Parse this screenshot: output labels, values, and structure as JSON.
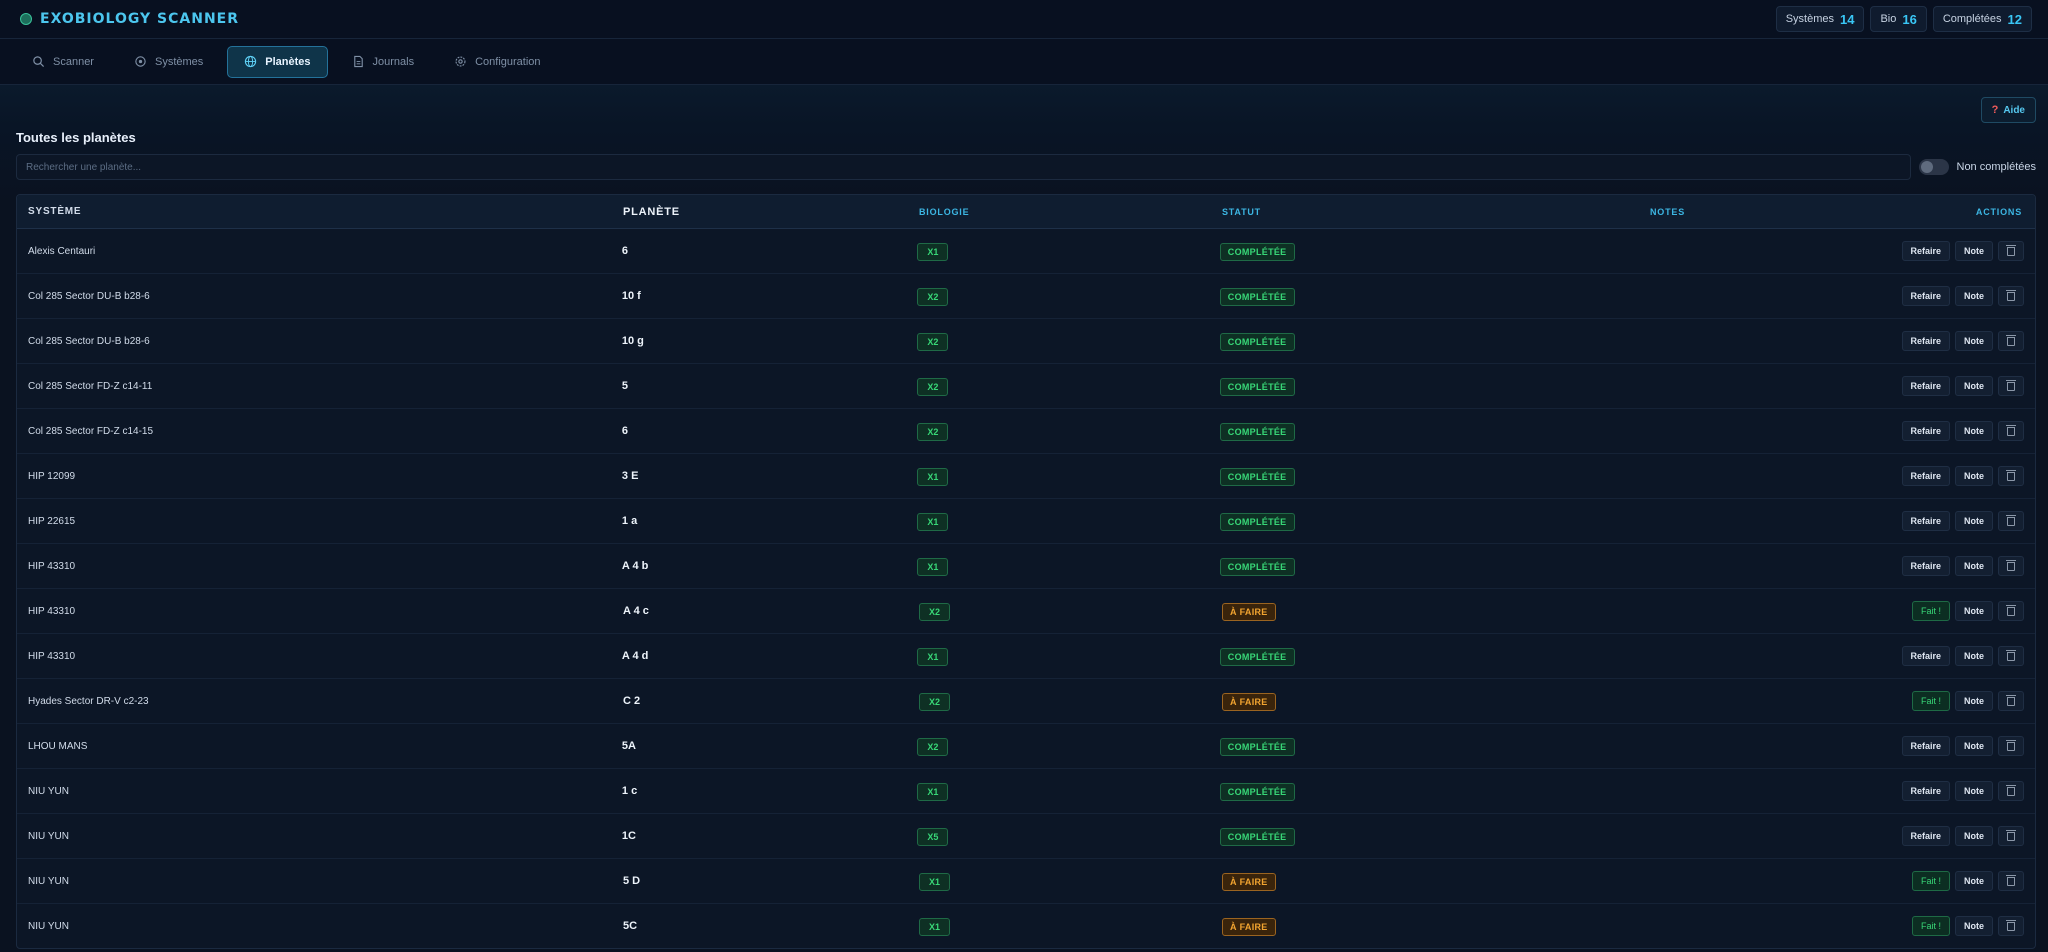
{
  "app": {
    "title": "EXOBIOLOGY SCANNER"
  },
  "stats": [
    {
      "label": "Systèmes",
      "value": "14"
    },
    {
      "label": "Bio",
      "value": "16"
    },
    {
      "label": "Complétées",
      "value": "12"
    }
  ],
  "tabs": [
    {
      "label": "Scanner",
      "icon": "search-icon"
    },
    {
      "label": "Systèmes",
      "icon": "target-icon"
    },
    {
      "label": "Planètes",
      "icon": "globe-icon",
      "active": true
    },
    {
      "label": "Journals",
      "icon": "document-icon"
    },
    {
      "label": "Configuration",
      "icon": "gear-icon"
    }
  ],
  "help": {
    "label": "Aide"
  },
  "page": {
    "title": "Toutes les planètes"
  },
  "search": {
    "placeholder": "Rechercher une planète..."
  },
  "filter": {
    "label": "Non complétées"
  },
  "table": {
    "headers": {
      "system": "SYSTÈME",
      "planet": "PLANÈTE",
      "bio": "BIOLOGIE",
      "status": "STATUT",
      "notes": "NOTES",
      "actions": "ACTIONS"
    },
    "rows": [
      {
        "system": "Alexis Centauri",
        "planet": "6",
        "bio": "X1",
        "status": "COMPLÉTÉE",
        "state": "done",
        "action": "Refaire"
      },
      {
        "system": "Col 285 Sector DU-B b28-6",
        "planet": "10 f",
        "bio": "X2",
        "status": "COMPLÉTÉE",
        "state": "done",
        "action": "Refaire"
      },
      {
        "system": "Col 285 Sector DU-B b28-6",
        "planet": "10 g",
        "bio": "X2",
        "status": "COMPLÉTÉE",
        "state": "done",
        "action": "Refaire"
      },
      {
        "system": "Col 285 Sector FD-Z c14-11",
        "planet": "5",
        "bio": "X2",
        "status": "COMPLÉTÉE",
        "state": "done",
        "action": "Refaire"
      },
      {
        "system": "Col 285 Sector FD-Z c14-15",
        "planet": "6",
        "bio": "X2",
        "status": "COMPLÉTÉE",
        "state": "done",
        "action": "Refaire"
      },
      {
        "system": "HIP 12099",
        "planet": "3 E",
        "bio": "X1",
        "status": "COMPLÉTÉE",
        "state": "done",
        "action": "Refaire"
      },
      {
        "system": "HIP 22615",
        "planet": "1 a",
        "bio": "X1",
        "status": "COMPLÉTÉE",
        "state": "done",
        "action": "Refaire"
      },
      {
        "system": "HIP 43310",
        "planet": "A 4 b",
        "bio": "X1",
        "status": "COMPLÉTÉE",
        "state": "done",
        "action": "Refaire"
      },
      {
        "system": "HIP 43310",
        "planet": "A 4 c",
        "bio": "X2",
        "status": "À FAIRE",
        "state": "todo",
        "action": "Fait !"
      },
      {
        "system": "HIP 43310",
        "planet": "A 4 d",
        "bio": "X1",
        "status": "COMPLÉTÉE",
        "state": "done",
        "action": "Refaire"
      },
      {
        "system": "Hyades Sector DR-V c2-23",
        "planet": "C 2",
        "bio": "X2",
        "status": "À FAIRE",
        "state": "todo",
        "action": "Fait !"
      },
      {
        "system": "LHOU MANS",
        "planet": "5A",
        "bio": "X2",
        "status": "COMPLÉTÉE",
        "state": "done",
        "action": "Refaire"
      },
      {
        "system": "NIU YUN",
        "planet": "1 c",
        "bio": "X1",
        "status": "COMPLÉTÉE",
        "state": "done",
        "action": "Refaire"
      },
      {
        "system": "NIU YUN",
        "planet": "1C",
        "bio": "X5",
        "status": "COMPLÉTÉE",
        "state": "done",
        "action": "Refaire"
      },
      {
        "system": "NIU YUN",
        "planet": "5 D",
        "bio": "X1",
        "status": "À FAIRE",
        "state": "todo",
        "action": "Fait !"
      },
      {
        "system": "NIU YUN",
        "planet": "5C",
        "bio": "X1",
        "status": "À FAIRE",
        "state": "todo",
        "action": "Fait !"
      }
    ],
    "note_label": "Note"
  }
}
